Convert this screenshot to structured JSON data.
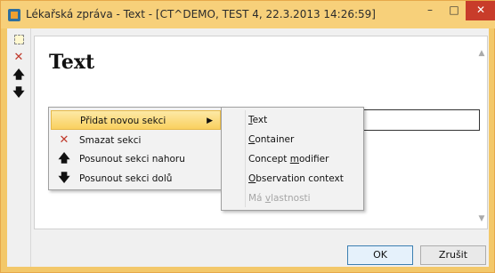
{
  "window": {
    "title": "Lékařská zpráva - Text - [CT^DEMO, TEST 4, 22.3.2013 14:26:59]",
    "minimize_glyph": "–",
    "maximize_glyph": "□",
    "close_glyph": "✕"
  },
  "toolbar": {
    "new_section_icon": "new-section-icon",
    "delete_glyph": "✕",
    "move_up_glyph": "🡅",
    "move_down_glyph": "🡇"
  },
  "document": {
    "section_title": "Text",
    "text_value": ""
  },
  "context_menu": {
    "items": [
      {
        "label": "Přidat novou sekci",
        "icon": "",
        "has_submenu": true,
        "highlighted": true
      },
      {
        "label": "Smazat sekci",
        "icon": "✕"
      },
      {
        "label": "Posunout sekci nahoru",
        "icon": "🡅"
      },
      {
        "label": "Posunout sekci dolů",
        "icon": "🡇"
      }
    ],
    "submenu_arrow": "▶"
  },
  "submenu": {
    "items": [
      {
        "pre": "",
        "acc": "T",
        "post": "ext",
        "enabled": true
      },
      {
        "pre": "",
        "acc": "C",
        "post": "ontainer",
        "enabled": true
      },
      {
        "pre": "Concept ",
        "acc": "m",
        "post": "odifier",
        "enabled": true
      },
      {
        "pre": "",
        "acc": "O",
        "post": "bservation context",
        "enabled": true
      },
      {
        "pre": "Má ",
        "acc": "v",
        "post": "lastnosti",
        "enabled": false
      }
    ]
  },
  "buttons": {
    "ok_label": "OK",
    "cancel_label": "Zrušit"
  },
  "colors": {
    "title_bar": "#f7d07a",
    "close_button": "#c83c2a",
    "menu_highlight": "#f9d05f",
    "delete_red": "#c0392b"
  }
}
